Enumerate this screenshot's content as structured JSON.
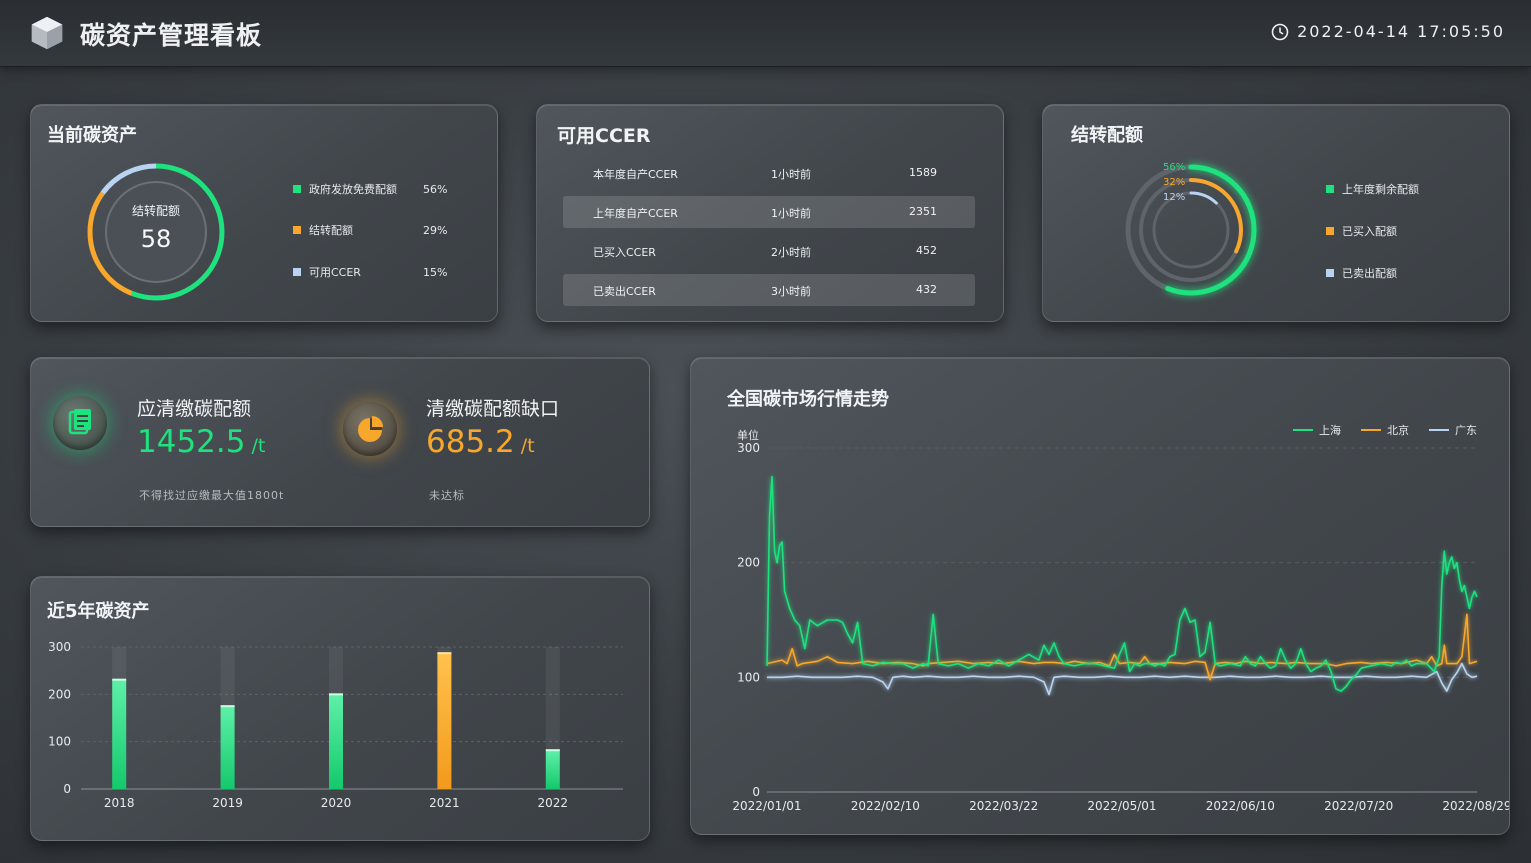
{
  "header": {
    "title": "碳资产管理看板",
    "datetime": "2022-04-14 17:05:50",
    "clock_icon": "clock-icon",
    "logo_icon": "cube-logo-icon"
  },
  "colors": {
    "green": "#1ee27e",
    "orange": "#f7a72c",
    "light_blue": "#b9d4f2"
  },
  "current_assets": {
    "title": "当前碳资产",
    "center_label": "结转配额",
    "center_value": "58",
    "legend": [
      {
        "label": "政府发放免费配额",
        "pct": "56%",
        "color": "#1ee27e"
      },
      {
        "label": "结转配额",
        "pct": "29%",
        "color": "#f7a72c"
      },
      {
        "label": "可用CCER",
        "pct": "15%",
        "color": "#b9d4f2"
      }
    ]
  },
  "ccer": {
    "title": "可用CCER",
    "rows": [
      {
        "name": "本年度自产CCER",
        "time": "1小时前",
        "value": "1589"
      },
      {
        "name": "上年度自产CCER",
        "time": "1小时前",
        "value": "2351"
      },
      {
        "name": "已买入CCER",
        "time": "2小时前",
        "value": "452"
      },
      {
        "name": "已卖出CCER",
        "time": "3小时前",
        "value": "432"
      }
    ]
  },
  "carryover": {
    "title": "结转配额",
    "ring_labels": [
      "56%",
      "32%",
      "12%"
    ],
    "ring_values": [
      56,
      32,
      12
    ],
    "legend": [
      {
        "label": "上年度剩余配额",
        "color": "#1ee27e"
      },
      {
        "label": "已买入配额",
        "color": "#f7a72c"
      },
      {
        "label": "已卖出配额",
        "color": "#b9d4f2"
      }
    ]
  },
  "quota": {
    "due_label": "应清缴碳配额",
    "due_value": "1452.5",
    "due_unit": "/t",
    "due_note": "不得找过应缴最大值1800t",
    "gap_label": "清缴碳配额缺口",
    "gap_value": "685.2",
    "gap_unit": "/t",
    "gap_note": "未达标",
    "due_icon": "document-icon",
    "gap_icon": "pie-chart-icon"
  },
  "five_year": {
    "title": "近5年碳资产",
    "chart_data": {
      "type": "bar",
      "categories": [
        "2018",
        "2019",
        "2020",
        "2021",
        "2022"
      ],
      "values": [
        231,
        175,
        200,
        287,
        82
      ],
      "highlight_index": 3,
      "ylim": [
        0,
        300
      ],
      "yticks": [
        "300",
        "200",
        "100",
        "0"
      ]
    }
  },
  "market": {
    "title": "全国碳市场行情走势",
    "unit_label": "单位",
    "chart_data": {
      "type": "line",
      "ylim": [
        0,
        300
      ],
      "yticks": [
        "300",
        "200",
        "100",
        "0"
      ],
      "xticks": [
        "2022/01/01",
        "2022/02/10",
        "2022/03/22",
        "2022/05/01",
        "2022/06/10",
        "2022/07/20",
        "2022/08/29"
      ],
      "x_range_days": 240,
      "series": [
        {
          "name": "上海",
          "color": "#1ee27e",
          "points": [
            [
              0,
              110
            ],
            [
              1,
              240
            ],
            [
              2,
              275
            ],
            [
              3,
              210
            ],
            [
              4,
              200
            ],
            [
              5,
              215
            ],
            [
              6,
              218
            ],
            [
              7,
              175
            ],
            [
              9,
              160
            ],
            [
              11,
              150
            ],
            [
              13,
              145
            ],
            [
              15,
              125
            ],
            [
              17,
              150
            ],
            [
              20,
              145
            ],
            [
              24,
              150
            ],
            [
              28,
              150
            ],
            [
              30,
              148
            ],
            [
              32,
              138
            ],
            [
              34,
              130
            ],
            [
              36,
              148
            ],
            [
              38,
              112
            ],
            [
              42,
              110
            ],
            [
              46,
              113
            ],
            [
              50,
              112
            ],
            [
              54,
              112
            ],
            [
              58,
              108
            ],
            [
              62,
              112
            ],
            [
              64,
              110
            ],
            [
              66,
              155
            ],
            [
              68,
              112
            ],
            [
              72,
              110
            ],
            [
              76,
              112
            ],
            [
              80,
              108
            ],
            [
              84,
              112
            ],
            [
              88,
              110
            ],
            [
              92,
              115
            ],
            [
              96,
              110
            ],
            [
              100,
              115
            ],
            [
              104,
              120
            ],
            [
              108,
              115
            ],
            [
              110,
              128
            ],
            [
              112,
              120
            ],
            [
              114,
              130
            ],
            [
              116,
              118
            ],
            [
              118,
              112
            ],
            [
              122,
              110
            ],
            [
              126,
              112
            ],
            [
              130,
              112
            ],
            [
              134,
              110
            ],
            [
              138,
              108
            ],
            [
              140,
              120
            ],
            [
              142,
              130
            ],
            [
              144,
              105
            ],
            [
              146,
              112
            ],
            [
              148,
              110
            ],
            [
              150,
              112
            ],
            [
              152,
              112
            ],
            [
              154,
              110
            ],
            [
              156,
              112
            ],
            [
              158,
              110
            ],
            [
              160,
              118
            ],
            [
              162,
              120
            ],
            [
              164,
              150
            ],
            [
              166,
              160
            ],
            [
              168,
              148
            ],
            [
              170,
              150
            ],
            [
              172,
              118
            ],
            [
              174,
              122
            ],
            [
              176,
              148
            ],
            [
              178,
              112
            ],
            [
              180,
              110
            ],
            [
              184,
              112
            ],
            [
              188,
              110
            ],
            [
              190,
              118
            ],
            [
              192,
              112
            ],
            [
              194,
              110
            ],
            [
              196,
              118
            ],
            [
              198,
              112
            ],
            [
              200,
              108
            ],
            [
              202,
              110
            ],
            [
              204,
              125
            ],
            [
              206,
              115
            ],
            [
              208,
              108
            ],
            [
              210,
              112
            ],
            [
              212,
              125
            ],
            [
              214,
              112
            ],
            [
              216,
              105
            ],
            [
              218,
              108
            ],
            [
              220,
              110
            ],
            [
              222,
              115
            ],
            [
              224,
              105
            ],
            [
              226,
              90
            ],
            [
              228,
              88
            ],
            [
              230,
              92
            ],
            [
              232,
              98
            ],
            [
              234,
              102
            ],
            [
              236,
              108
            ],
            [
              240,
              110
            ],
            [
              244,
              112
            ],
            [
              248,
              110
            ],
            [
              250,
              113
            ],
            [
              252,
              112
            ],
            [
              254,
              115
            ],
            [
              256,
              110
            ],
            [
              258,
              112
            ],
            [
              262,
              112
            ],
            [
              265,
              105
            ],
            [
              267,
              118
            ],
            [
              268,
              180
            ],
            [
              269,
              210
            ],
            [
              270,
              190
            ],
            [
              271,
              200
            ],
            [
              272,
              205
            ],
            [
              273,
              195
            ],
            [
              274,
              200
            ],
            [
              275,
              185
            ],
            [
              276,
              175
            ],
            [
              277,
              180
            ],
            [
              278,
              170
            ],
            [
              279,
              160
            ],
            [
              280,
              170
            ],
            [
              281,
              175
            ],
            [
              282,
              170
            ]
          ]
        },
        {
          "name": "北京",
          "color": "#f7a72c",
          "points": [
            [
              0,
              112
            ],
            [
              6,
              115
            ],
            [
              8,
              112
            ],
            [
              10,
              125
            ],
            [
              12,
              110
            ],
            [
              14,
              112
            ],
            [
              20,
              114
            ],
            [
              24,
              118
            ],
            [
              28,
              113
            ],
            [
              34,
              112
            ],
            [
              40,
              114
            ],
            [
              46,
              112
            ],
            [
              52,
              113
            ],
            [
              58,
              112
            ],
            [
              62,
              110
            ],
            [
              64,
              112
            ],
            [
              70,
              113
            ],
            [
              76,
              114
            ],
            [
              82,
              112
            ],
            [
              88,
              113
            ],
            [
              94,
              112
            ],
            [
              100,
              114
            ],
            [
              106,
              112
            ],
            [
              110,
              113
            ],
            [
              114,
              113
            ],
            [
              118,
              112
            ],
            [
              122,
              114
            ],
            [
              128,
              112
            ],
            [
              132,
              113
            ],
            [
              136,
              110
            ],
            [
              138,
              120
            ],
            [
              140,
              112
            ],
            [
              144,
              113
            ],
            [
              148,
              112
            ],
            [
              150,
              118
            ],
            [
              152,
              112
            ],
            [
              156,
              112
            ],
            [
              160,
              113
            ],
            [
              166,
              112
            ],
            [
              170,
              114
            ],
            [
              174,
              113
            ],
            [
              176,
              98
            ],
            [
              178,
              112
            ],
            [
              182,
              113
            ],
            [
              186,
              112
            ],
            [
              190,
              114
            ],
            [
              196,
              112
            ],
            [
              200,
              113
            ],
            [
              206,
              112
            ],
            [
              210,
              113
            ],
            [
              216,
              112
            ],
            [
              222,
              112
            ],
            [
              226,
              110
            ],
            [
              230,
              112
            ],
            [
              236,
              113
            ],
            [
              240,
              112
            ],
            [
              246,
              113
            ],
            [
              252,
              112
            ],
            [
              258,
              115
            ],
            [
              262,
              112
            ],
            [
              264,
              118
            ],
            [
              266,
              110
            ],
            [
              268,
              112
            ],
            [
              269,
              128
            ],
            [
              270,
              112
            ],
            [
              274,
              112
            ],
            [
              276,
              118
            ],
            [
              278,
              155
            ],
            [
              279,
              112
            ],
            [
              282,
              114
            ]
          ]
        },
        {
          "name": "广东",
          "color": "#b9d4f2",
          "points": [
            [
              0,
              100
            ],
            [
              6,
              100
            ],
            [
              12,
              101
            ],
            [
              18,
              100
            ],
            [
              24,
              100
            ],
            [
              30,
              100
            ],
            [
              36,
              101
            ],
            [
              42,
              100
            ],
            [
              46,
              96
            ],
            [
              48,
              90
            ],
            [
              50,
              100
            ],
            [
              54,
              101
            ],
            [
              58,
              100
            ],
            [
              64,
              101
            ],
            [
              70,
              100
            ],
            [
              76,
              100
            ],
            [
              82,
              101
            ],
            [
              88,
              100
            ],
            [
              94,
              100
            ],
            [
              100,
              101
            ],
            [
              106,
              100
            ],
            [
              110,
              96
            ],
            [
              112,
              85
            ],
            [
              114,
              100
            ],
            [
              118,
              101
            ],
            [
              124,
              100
            ],
            [
              130,
              100
            ],
            [
              136,
              101
            ],
            [
              142,
              100
            ],
            [
              148,
              100
            ],
            [
              154,
              101
            ],
            [
              160,
              100
            ],
            [
              166,
              101
            ],
            [
              172,
              100
            ],
            [
              178,
              100
            ],
            [
              184,
              101
            ],
            [
              190,
              100
            ],
            [
              196,
              100
            ],
            [
              202,
              101
            ],
            [
              208,
              100
            ],
            [
              214,
              100
            ],
            [
              220,
              101
            ],
            [
              226,
              100
            ],
            [
              232,
              100
            ],
            [
              238,
              101
            ],
            [
              244,
              100
            ],
            [
              250,
              100
            ],
            [
              256,
              101
            ],
            [
              262,
              100
            ],
            [
              266,
              105
            ],
            [
              268,
              95
            ],
            [
              270,
              88
            ],
            [
              272,
              98
            ],
            [
              274,
              104
            ],
            [
              276,
              112
            ],
            [
              278,
              103
            ],
            [
              280,
              100
            ],
            [
              282,
              101
            ]
          ]
        }
      ]
    }
  }
}
